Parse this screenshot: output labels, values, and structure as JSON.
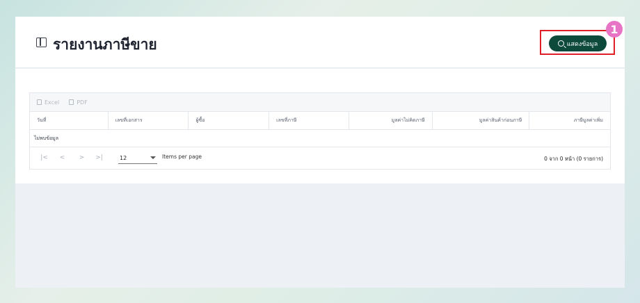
{
  "header": {
    "title": "รายงานภาษีขาย",
    "show_button_label": "แสดงข้อมูล",
    "step_number": "1"
  },
  "toolbar": {
    "excel_label": "Excel",
    "pdf_label": "PDF"
  },
  "table": {
    "columns": [
      "วันที่",
      "เลขที่เอกสาร",
      "ผู้ซื้อ",
      "เลขที่ภาษี",
      "มูลค่าไม่คิดภาษี",
      "มูลค่าสินค้าก่อนภาษี",
      "ภาษีมูลค่าเพิ่ม"
    ],
    "empty_text": "ไม่พบข้อมูล"
  },
  "pager": {
    "first": "|<",
    "prev": "<",
    "next": ">",
    "last": ">|",
    "page_size": "12",
    "items_per_page_label": "Items per page",
    "summary": "0 จาก 0 หน้า (0 รายการ)"
  },
  "colors": {
    "accent": "#0d4a3c",
    "highlight": "#e01e26",
    "badge": "#e774c4"
  }
}
